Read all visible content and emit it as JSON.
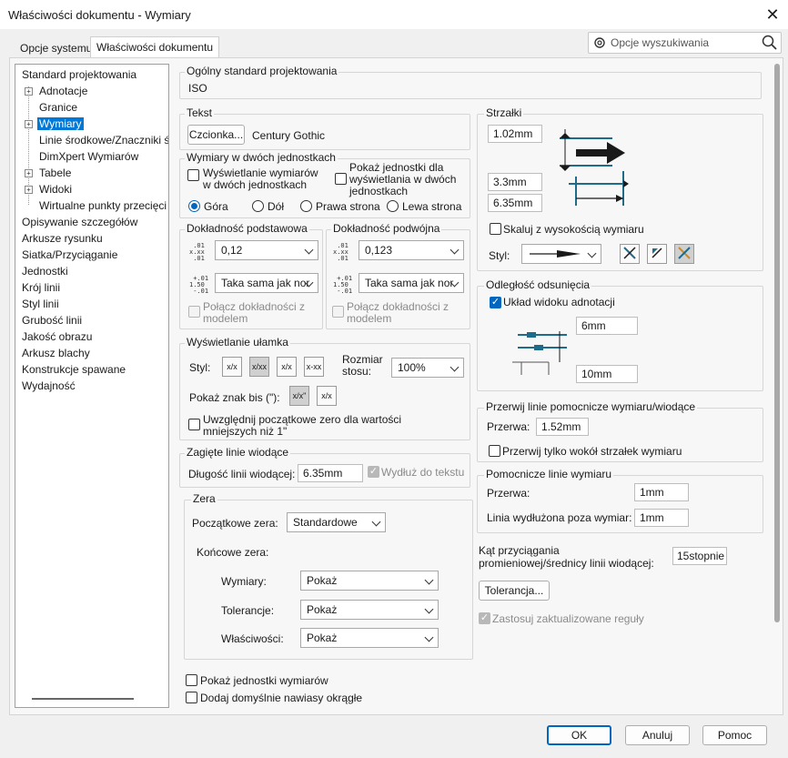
{
  "window": {
    "title": "Właściwości dokumentu - Wymiary"
  },
  "tabs": [
    {
      "label": "Opcje systemu"
    },
    {
      "label": "Właściwości dokumentu"
    }
  ],
  "search": {
    "placeholder": "Opcje wyszukiwania"
  },
  "tree": {
    "items": [
      "Standard projektowania",
      "Adnotacje",
      "Granice",
      "Wymiary",
      "Linie środkowe/Znaczniki ś",
      "DimXpert Wymiarów",
      "Tabele",
      "Widoki",
      "Wirtualne punkty przecięci",
      "Opisywanie szczegółów",
      "Arkusze rysunku",
      "Siatka/Przyciąganie",
      "Jednostki",
      "Krój linii",
      "Styl linii",
      "Grubość linii",
      "Jakość obrazu",
      "Arkusz blachy",
      "Konstrukcje spawane",
      "Wydajność"
    ]
  },
  "general_standard": {
    "label": "Ogólny standard projektowania",
    "value": "ISO"
  },
  "text": {
    "label": "Tekst",
    "font_button": "Czcionka...",
    "font_name": "Century Gothic"
  },
  "dual": {
    "label": "Wymiary w dwóch jednostkach",
    "show_dual_l1": "Wyświetlanie wymiarów",
    "show_dual_l2": "w dwóch jednostkach",
    "show_units_l1": "Pokaż jednostki dla",
    "show_units_l2": "wyświetlania w dwóch",
    "show_units_l3": "jednostkach",
    "pos_top": "Góra",
    "pos_bottom": "Dół",
    "pos_right": "Prawa strona",
    "pos_left": "Lewa strona"
  },
  "primary_precision": {
    "label": "Dokładność podstawowa",
    "value": "0,12",
    "tol": "Taka sama jak nor",
    "link_l1": "Połącz dokładności z",
    "link_l2": "modelem"
  },
  "dual_precision": {
    "label": "Dokładność podwójna",
    "value": "0,123",
    "tol": "Taka sama jak nor",
    "link_l1": "Połącz dokładności z",
    "link_l2": "modelem"
  },
  "fraction": {
    "label": "Wyświetlanie ułamka",
    "style": "Styl:",
    "stack_l1": "Rozmiar",
    "stack_l2": "stosu:",
    "stack_value": "100%",
    "show_bis": "Pokaż znak bis (\"):",
    "lead_zero_l1": "Uwzględnij początkowe zero dla wartości",
    "lead_zero_l2": "mniejszych niż 1\"",
    "icons": [
      "x/x",
      "x/xx",
      "x/x",
      "x-xx",
      "x/x\"",
      "x/x"
    ]
  },
  "bent_leader": {
    "label": "Zagięte linie wiodące",
    "length_label": "Długość linii wiodącej:",
    "length": "6.35mm",
    "extend": "Wydłuż do tekstu"
  },
  "zeros": {
    "label": "Zera",
    "leading_label": "Początkowe zera:",
    "leading": "Standardowe",
    "trailing_label": "Końcowe zera:",
    "dims_label": "Wymiary:",
    "dims": "Pokaż",
    "tol_label": "Tolerancje:",
    "tol": "Pokaż",
    "props_label": "Właściwości:",
    "props": "Pokaż"
  },
  "show_units": "Pokaż jednostki wymiarów",
  "add_parens": "Dodaj domyślnie nawiasy okrągłe",
  "arrows": {
    "label": "Strzałki",
    "v1": "1.02mm",
    "v2": "3.3mm",
    "v3": "6.35mm",
    "scale": "Skaluj z wysokością wymiaru",
    "style_label": "Styl:"
  },
  "offset": {
    "label": "Odległość odsunięcia",
    "layout": "Układ widoku adnotacji",
    "v1": "6mm",
    "v2": "10mm"
  },
  "break_lines": {
    "label": "Przerwij linie pomocnicze wymiaru/wiodące",
    "gap_label": "Przerwa:",
    "gap": "1.52mm",
    "only_arrows": "Przerwij tylko wokół strzałek wymiaru"
  },
  "ext_lines": {
    "label": "Pomocnicze linie wymiaru",
    "gap_label": "Przerwa:",
    "gap": "1mm",
    "beyond_label": "Linia wydłużona poza wymiar:",
    "beyond": "1mm"
  },
  "snap": {
    "l1": "Kąt przyciągania",
    "l2": "promieniowej/średnicy linii wiodącej:",
    "value": "15stopnie"
  },
  "tolerance_button": "Tolerancja...",
  "apply_rules": "Zastosuj zaktualizowane reguły",
  "footer": {
    "ok": "OK",
    "cancel": "Anuluj",
    "help": "Pomoc"
  },
  "colors": {
    "accent": "#0067c0",
    "selection": "#0078d7",
    "diagram_teal": "#1e6b8a"
  }
}
